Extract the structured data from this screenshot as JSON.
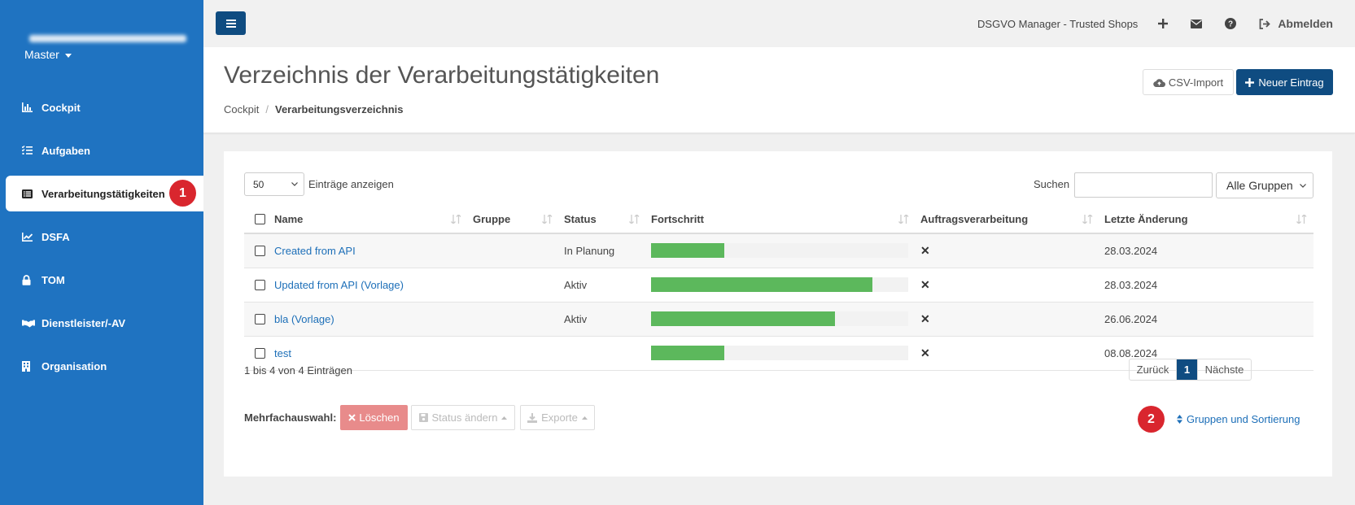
{
  "sidebar": {
    "account_menu": "Master",
    "items": [
      {
        "label": "Cockpit",
        "icon": "chart-bar-icon"
      },
      {
        "label": "Aufgaben",
        "icon": "tasks-icon"
      },
      {
        "label": "Verarbeitungstätigkeiten",
        "icon": "list-alt-icon",
        "active": true,
        "badge": "1"
      },
      {
        "label": "DSFA",
        "icon": "chart-line-icon"
      },
      {
        "label": "TOM",
        "icon": "lock-icon"
      },
      {
        "label": "Dienstleister/-AV",
        "icon": "handshake-icon"
      },
      {
        "label": "Organisation",
        "icon": "building-icon"
      }
    ]
  },
  "topbar": {
    "app_name": "DSGVO Manager - Trusted Shops",
    "logout_label": "Abmelden"
  },
  "header": {
    "title": "Verzeichnis der Verarbeitungstätigkeiten",
    "breadcrumb": [
      "Cockpit",
      "Verarbeitungsverzeichnis"
    ],
    "csv_import_label": "CSV-Import",
    "new_entry_label": "Neuer Eintrag"
  },
  "table_controls": {
    "page_length": "50",
    "page_length_label": "Einträge anzeigen",
    "search_label": "Suchen",
    "search_value": "",
    "group_filter": "Alle Gruppen"
  },
  "table": {
    "columns": [
      "Name",
      "Gruppe",
      "Status",
      "Fortschritt",
      "Auftragsverarbeitung",
      "Letzte Änderung"
    ],
    "rows": [
      {
        "name": "Created from API",
        "gruppe": "",
        "status": "In Planung",
        "progress": 0.285,
        "av": "✕",
        "date": "28.03.2024"
      },
      {
        "name": "Updated from API (Vorlage)",
        "gruppe": "",
        "status": "Aktiv",
        "progress": 0.86,
        "av": "✕",
        "date": "28.03.2024"
      },
      {
        "name": "bla (Vorlage)",
        "gruppe": "",
        "status": "Aktiv",
        "progress": 0.715,
        "av": "✕",
        "date": "26.06.2024"
      },
      {
        "name": "test",
        "gruppe": "",
        "status": "",
        "progress": 0.285,
        "av": "✕",
        "date": "08.08.2024"
      }
    ]
  },
  "footer": {
    "info": "1 bis 4 von 4 Einträgen",
    "pager": {
      "prev": "Zurück",
      "current": "1",
      "next": "Nächste"
    },
    "multi_label": "Mehrfachauswahl:",
    "delete_label": "Löschen",
    "status_label": "Status ändern",
    "export_label": "Exporte",
    "groups_sort_label": "Gruppen und Sortierung",
    "groups_sort_badge": "2"
  },
  "colors": {
    "sidebar": "#1f73c1",
    "primary": "#0f4c81",
    "progress": "#5cb85c",
    "badge": "#d9262e",
    "delete": "#e88b8b",
    "link": "#1d6fb8"
  }
}
